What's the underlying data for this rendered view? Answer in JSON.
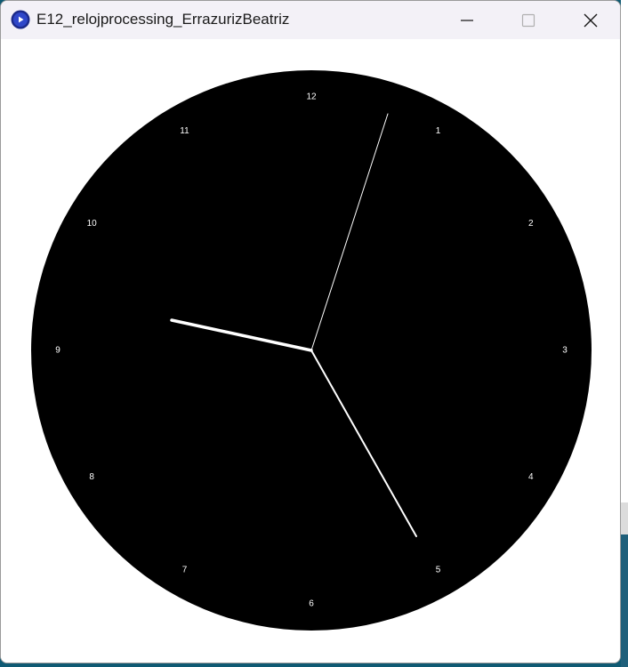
{
  "window": {
    "title": "E12_relojprocessing_ErrazurizBeatriz",
    "app_icon": "processing-app-icon",
    "controls": {
      "minimize_icon": "minimize-icon",
      "maximize_icon": "maximize-icon",
      "close_icon": "close-icon"
    }
  },
  "clock": {
    "face_color": "#000000",
    "hand_color": "#ffffff",
    "numbers": [
      "12",
      "1",
      "2",
      "3",
      "4",
      "5",
      "6",
      "7",
      "8",
      "9",
      "10",
      "11"
    ]
  }
}
